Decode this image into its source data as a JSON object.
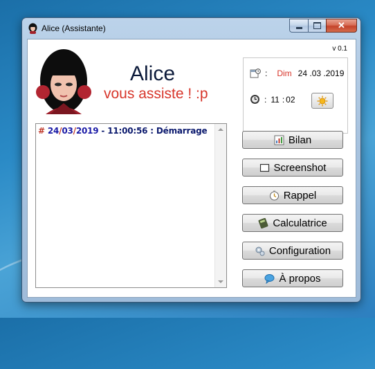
{
  "window": {
    "title": "Alice (Assistante)"
  },
  "header": {
    "version": "v 0.1",
    "name": "Alice",
    "tagline": "vous assiste ! :p"
  },
  "info": {
    "day": "Dim",
    "date": "24 .03 .2019",
    "hour": "11",
    "minute": "02",
    "time_sep": ":",
    "date_sep": ":"
  },
  "log": {
    "entries": [
      {
        "hash": "#",
        "day": "24",
        "month": "03",
        "year": "2019",
        "dash1": " - ",
        "time": "11:00:56",
        "colon": " : ",
        "event": "Démarrage"
      }
    ]
  },
  "buttons": {
    "bilan": "Bilan",
    "screenshot": "Screenshot",
    "rappel": "Rappel",
    "calculatrice": "Calculatrice",
    "configuration": "Configuration",
    "apropos": "À propos"
  },
  "colors": {
    "accent_red": "#d7352a",
    "log_blue": "#0c1a6e",
    "close_red": "#c4432a"
  },
  "icons": [
    "app-avatar-icon",
    "minimize-icon",
    "maximize-icon",
    "close-icon",
    "calendar-icon",
    "clock-icon",
    "sun-icon",
    "chart-icon",
    "screenshot-icon",
    "timer-icon",
    "calculator-icon",
    "gear-icon",
    "speech-bubble-icon"
  ]
}
